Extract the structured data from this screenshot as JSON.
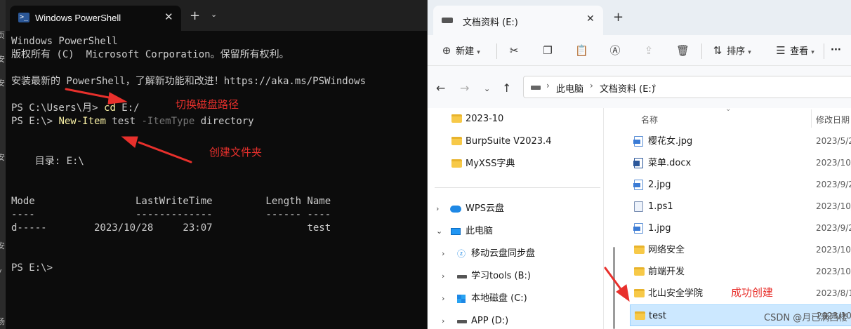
{
  "edge_glyphs": [
    "页",
    "安",
    "安",
    "安",
    "安",
    "y",
    "汤"
  ],
  "terminal": {
    "tab_title": "Windows PowerShell",
    "ps_icon": "powershell-icon",
    "close_glyph": "✕",
    "newtab_glyph": "+",
    "dropdown_glyph": "⌄",
    "lines": {
      "l1": "Windows PowerShell",
      "l2": "版权所有 (C)  Microsoft Corporation。保留所有权利。",
      "l3": "安装最新的 PowerShell，了解新功能和改进！https://aka.ms/PSWindows",
      "p1_prompt": "PS C:\\Users\\月> ",
      "p1_cmd": "cd",
      "p1_arg": " E:/",
      "p2_prompt": "PS E:\\> ",
      "p2_cmd": "New-Item",
      "p2_arg1": " test ",
      "p2_param": "-ItemType",
      "p2_arg2": " directory",
      "dir_label": "    目录: E:\\",
      "hdr": "Mode                 LastWriteTime         Length Name",
      "hdr_ul": "----                 -------------         ------ ----",
      "row": "d-----        2023/10/28     23:07                test",
      "p3": "PS E:\\>"
    },
    "annotations": {
      "switch_path": "切换磁盘路径",
      "create_folder": "创建文件夹"
    }
  },
  "explorer": {
    "tab_title": "文档资料 (E:)",
    "close_glyph": "✕",
    "newtab_glyph": "+",
    "toolbar": {
      "new_label": "新建",
      "sort_label": "排序",
      "view_label": "查看",
      "more_glyph": "···"
    },
    "address": {
      "seg1": "此电脑",
      "seg2": "文档资料 (E:)",
      "chevron": "›"
    },
    "nav_items": [
      {
        "label": "2023-10",
        "icon": "folder-icon"
      },
      {
        "label": "BurpSuite V2023.4",
        "icon": "folder-icon"
      },
      {
        "label": "MyXSS字典",
        "icon": "folder-icon"
      },
      {
        "label": "WPS云盘",
        "icon": "cloud-icon"
      },
      {
        "label": "此电脑",
        "icon": "pc-icon"
      },
      {
        "label": "移动云盘同步盘",
        "icon": "sync-icon"
      },
      {
        "label": "学习tools (B:)",
        "icon": "drive-icon"
      },
      {
        "label": "本地磁盘 (C:)",
        "icon": "windows-drive-icon"
      },
      {
        "label": "APP (D:)",
        "icon": "drive-icon"
      }
    ],
    "columns": {
      "name": "名称",
      "modified": "修改日期"
    },
    "files": [
      {
        "name": "樱花女.jpg",
        "date": "2023/5/2",
        "icon": "jpg-file-icon"
      },
      {
        "name": "菜单.docx",
        "date": "2023/10/",
        "icon": "docx-file-icon"
      },
      {
        "name": "2.jpg",
        "date": "2023/9/2",
        "icon": "jpg-file-icon"
      },
      {
        "name": "1.ps1",
        "date": "2023/10/",
        "icon": "ps1-file-icon"
      },
      {
        "name": "1.jpg",
        "date": "2023/9/2",
        "icon": "jpg-file-icon"
      },
      {
        "name": "网络安全",
        "date": "2023/10/",
        "icon": "folder-icon"
      },
      {
        "name": "前端开发",
        "date": "2023/10/",
        "icon": "folder-icon"
      },
      {
        "name": "北山安全学院",
        "date": "2023/8/1",
        "icon": "folder-icon"
      },
      {
        "name": "test",
        "date": "2023/10/",
        "icon": "folder-icon"
      }
    ],
    "annotation_success": "成功创建"
  },
  "watermark": "CSDN @月已满西楼",
  "colors": {
    "annotation": "#e8302c",
    "prompt_cmd": "#f9f1a5",
    "param": "#767676",
    "selection": "#cce8ff"
  }
}
